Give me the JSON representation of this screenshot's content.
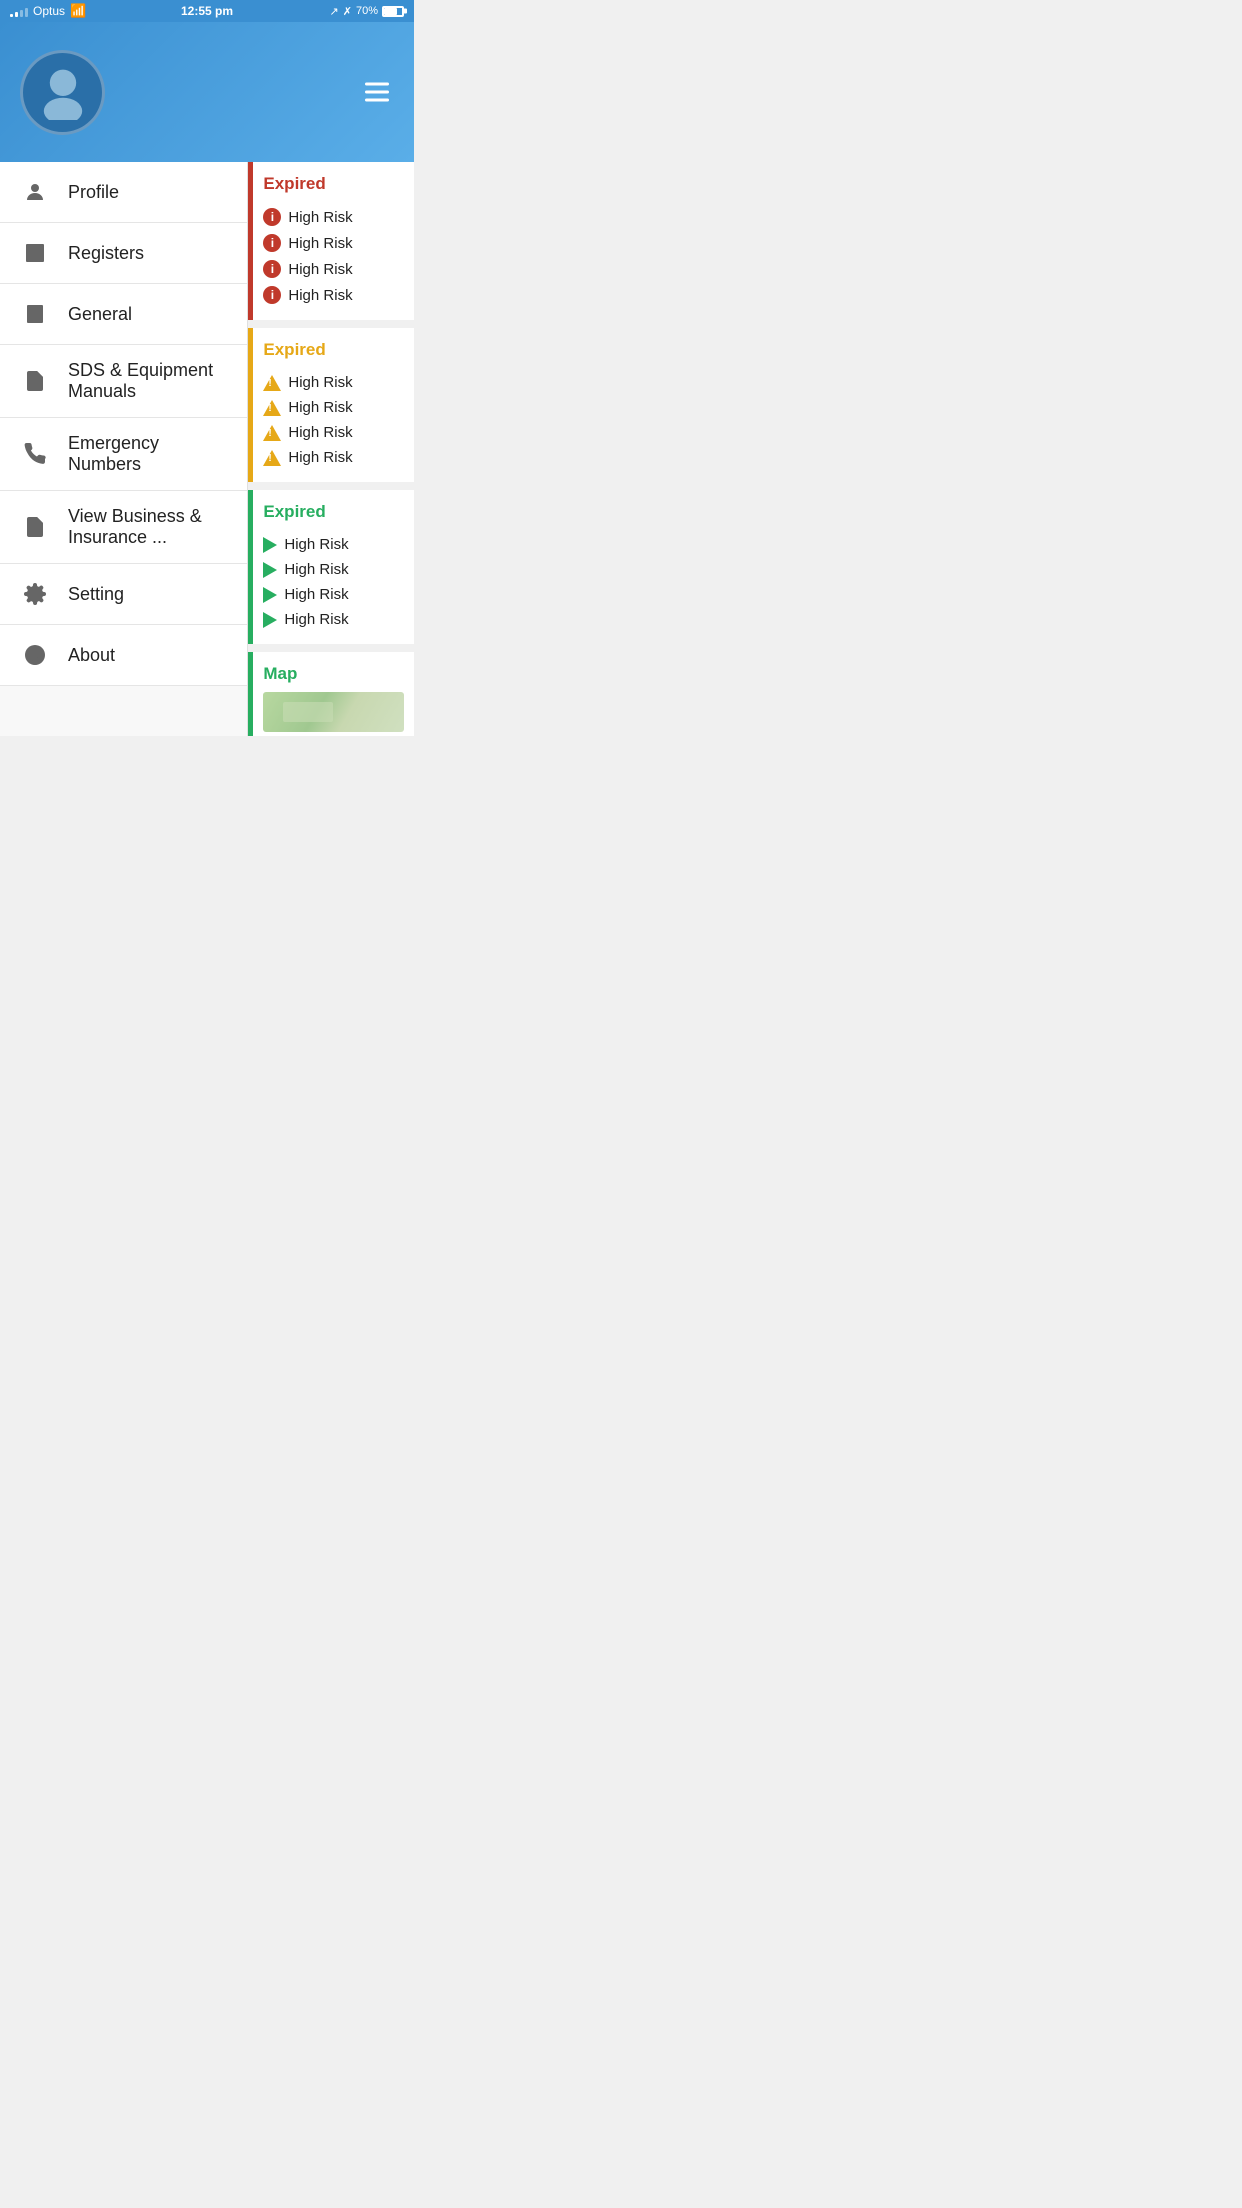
{
  "statusBar": {
    "carrier": "Optus",
    "time": "12:55 pm",
    "battery": "70%"
  },
  "header": {
    "hamburgerLabel": "menu"
  },
  "sidebar": {
    "items": [
      {
        "id": "profile",
        "label": "Profile"
      },
      {
        "id": "registers",
        "label": "Registers"
      },
      {
        "id": "general",
        "label": "General"
      },
      {
        "id": "sds",
        "label": "SDS & Equipment Manuals"
      },
      {
        "id": "emergency",
        "label": "Emergency Numbers"
      },
      {
        "id": "business",
        "label": "View Business & Insurance ..."
      },
      {
        "id": "setting",
        "label": "Setting"
      },
      {
        "id": "about",
        "label": "About"
      }
    ]
  },
  "rightPanel": {
    "cards": [
      {
        "id": "card-red",
        "type": "red",
        "title": "Expired",
        "items": [
          "High Risk",
          "High Risk",
          "High Risk",
          "High Risk"
        ],
        "iconType": "info-red"
      },
      {
        "id": "card-orange",
        "type": "orange",
        "title": "Expired",
        "items": [
          "High Risk",
          "High Risk",
          "High Risk",
          "High Risk"
        ],
        "iconType": "warn-orange"
      },
      {
        "id": "card-green",
        "type": "green",
        "title": "Expired",
        "items": [
          "High Risk",
          "High Risk",
          "High Risk",
          "High Risk"
        ],
        "iconType": "play-green"
      },
      {
        "id": "card-map",
        "type": "map",
        "title": "Map"
      }
    ]
  }
}
